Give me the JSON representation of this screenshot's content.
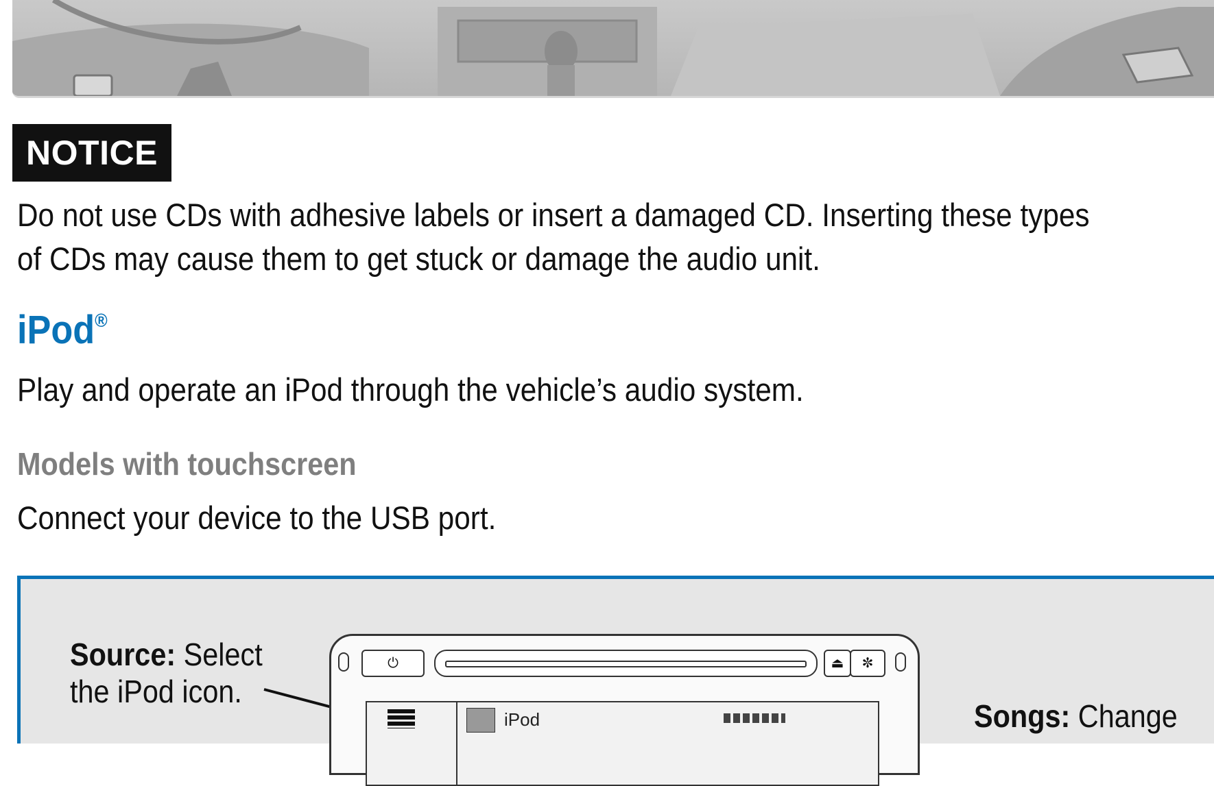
{
  "notice": {
    "label": "NOTICE"
  },
  "notice_text": {
    "line1": "Do not use CDs with adhesive labels or insert a damaged CD. Inserting these types",
    "line2": "of CDs may cause them to get stuck or damage the audio unit."
  },
  "ipod_section": {
    "title": "iPod",
    "reg_mark": "®",
    "intro": "Play and operate an iPod through the vehicle’s audio system."
  },
  "models_section": {
    "subhead": "Models with touchscreen",
    "instruction": "Connect your device to the USB port."
  },
  "figure": {
    "source_callout": {
      "bold": "Source:",
      "text1": " Select",
      "text2": "the iPod icon."
    },
    "songs_callout": {
      "bold": "Songs:",
      "text": " Change"
    },
    "screen_label": "iPod",
    "power_icon": "power-icon",
    "eject_icon": "eject-icon",
    "brightness_icon": "brightness-icon"
  },
  "colors": {
    "heading": "#0a73b7",
    "subhead": "#7f7f7f",
    "box_border": "#0a73b7",
    "notice_bg": "#111111"
  }
}
